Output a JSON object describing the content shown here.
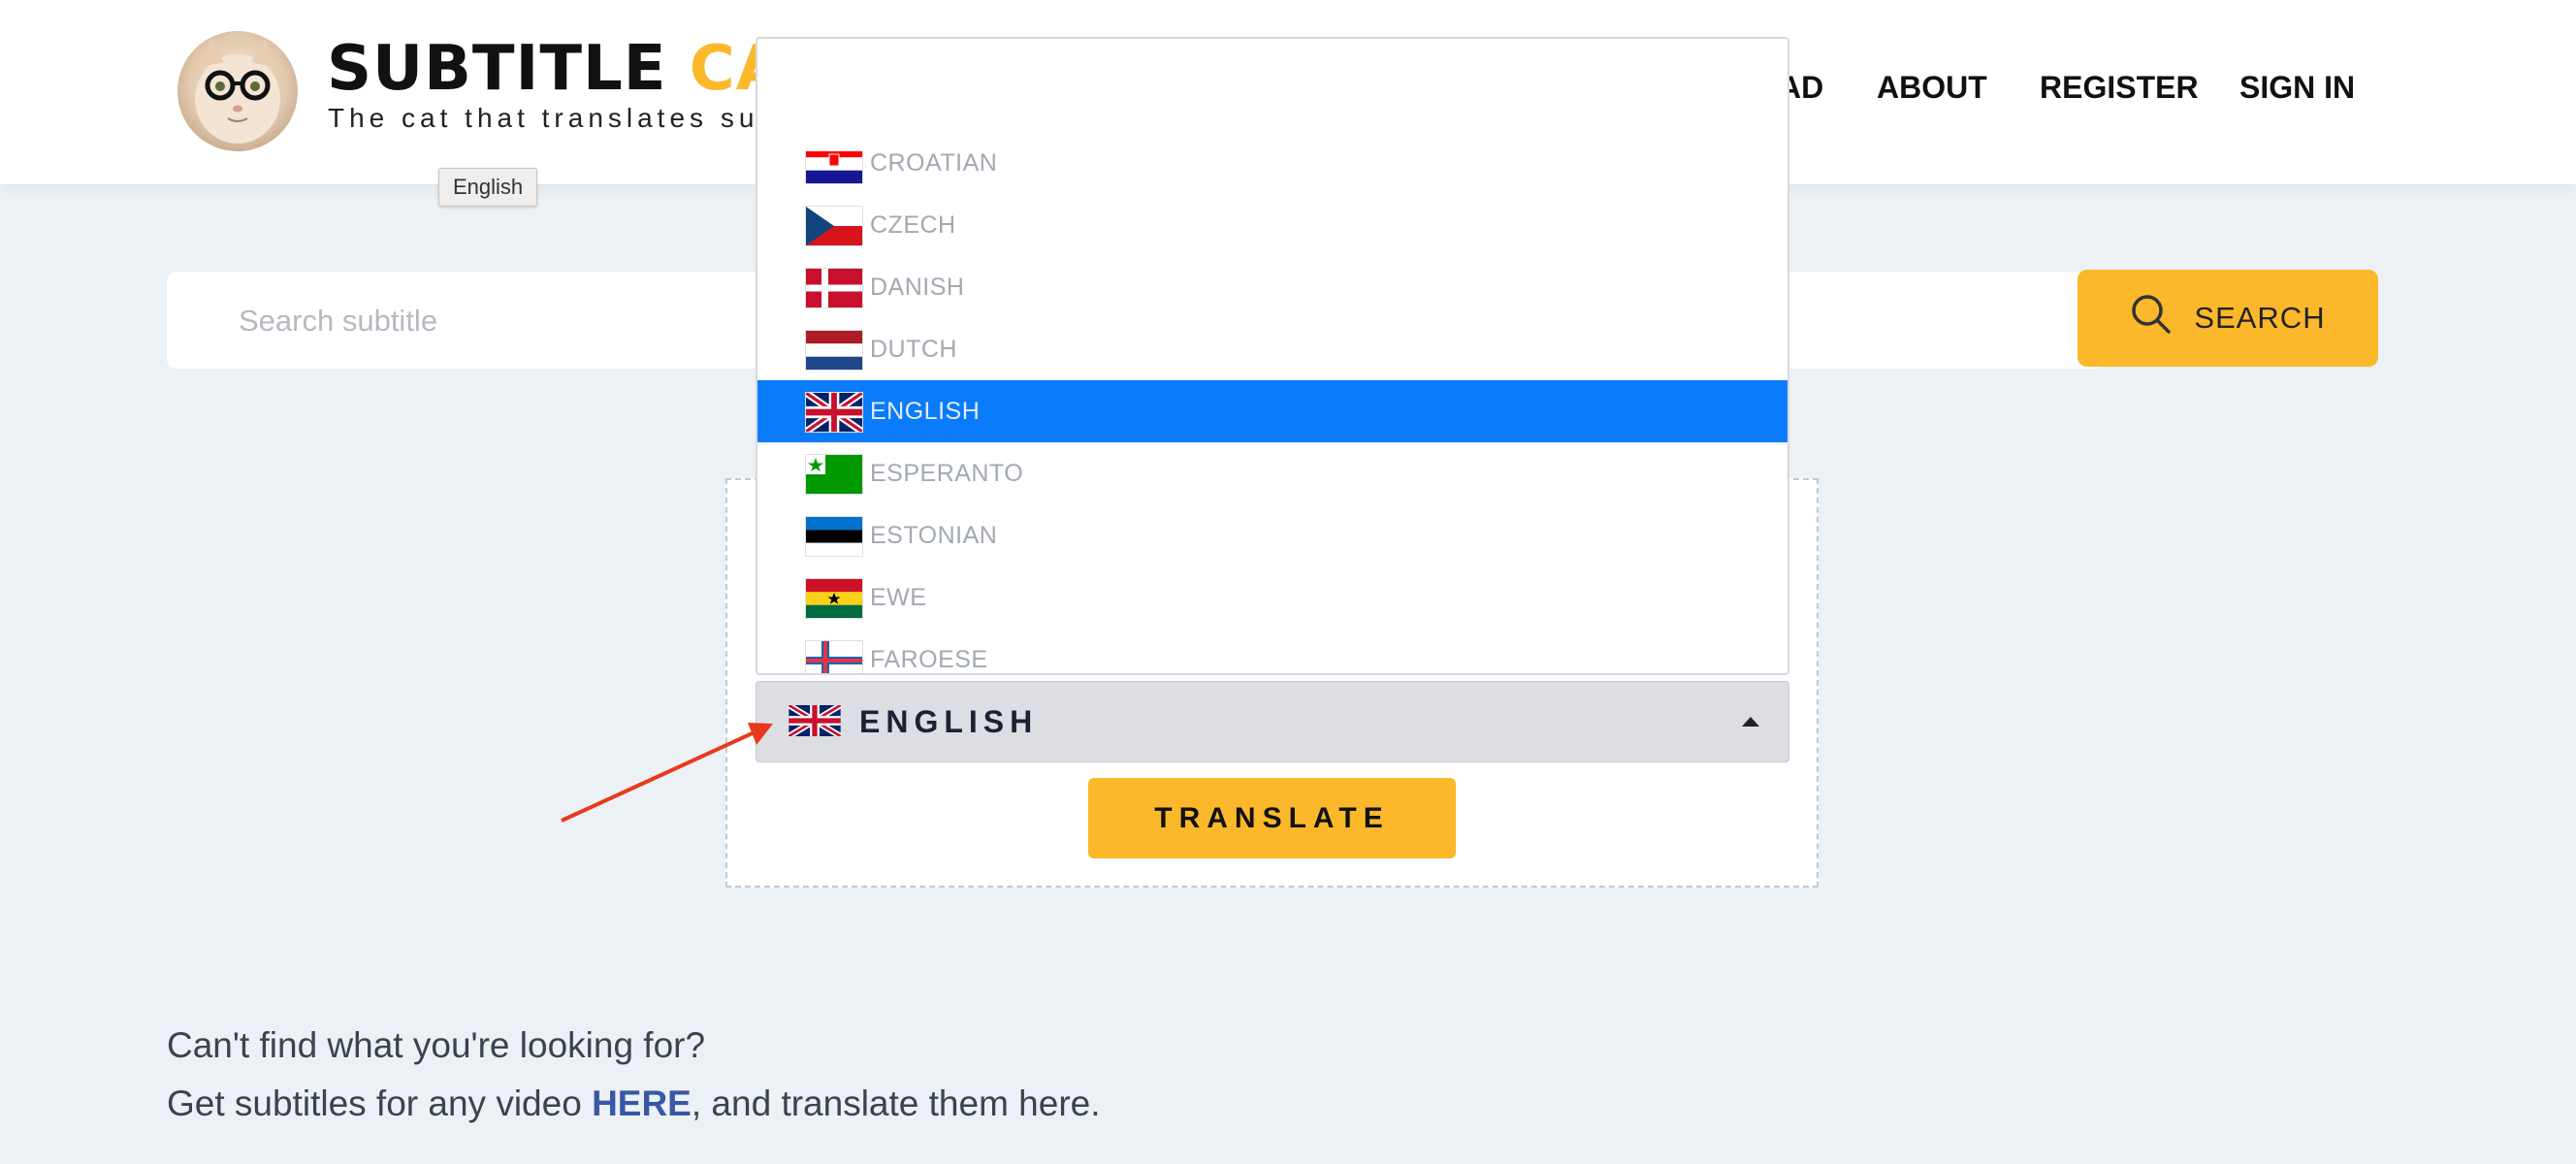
{
  "header": {
    "brand_main": "SUBTITLE",
    "brand_accent": "CAT",
    "tagline": "The cat that translates sub",
    "nav": {
      "download_partial": "AD",
      "about": "ABOUT",
      "register": "REGISTER",
      "sign_in": "SIGN IN"
    }
  },
  "tooltip": {
    "text": "English"
  },
  "search": {
    "placeholder": "Search subtitle",
    "button_label": "SEARCH"
  },
  "language_dropdown": {
    "items": [
      {
        "label": "CROATIAN",
        "flag": "croatia-flag-icon"
      },
      {
        "label": "CZECH",
        "flag": "czech-flag-icon"
      },
      {
        "label": "DANISH",
        "flag": "denmark-flag-icon"
      },
      {
        "label": "DUTCH",
        "flag": "netherlands-flag-icon"
      },
      {
        "label": "ENGLISH",
        "flag": "uk-flag-icon",
        "selected": true
      },
      {
        "label": "ESPERANTO",
        "flag": "esperanto-flag-icon"
      },
      {
        "label": "ESTONIAN",
        "flag": "estonia-flag-icon"
      },
      {
        "label": "EWE",
        "flag": "ghana-flag-icon"
      },
      {
        "label": "FAROESE",
        "flag": "faroe-flag-icon"
      }
    ],
    "selected_color": "#0a7bfa"
  },
  "language_select": {
    "value": "ENGLISH",
    "flag": "uk-flag-icon"
  },
  "translate_button": {
    "label": "TRANSLATE"
  },
  "footer_prompt": {
    "line1": "Can't find what you're looking for?",
    "line2_prefix": "Get subtitles for any video ",
    "line2_link": "HERE",
    "line2_suffix": ", and translate them here."
  },
  "colors": {
    "accent": "#fbb82a",
    "background": "#ecf1f5",
    "link": "#3a57a6",
    "annotation_arrow": "#e8391c"
  }
}
